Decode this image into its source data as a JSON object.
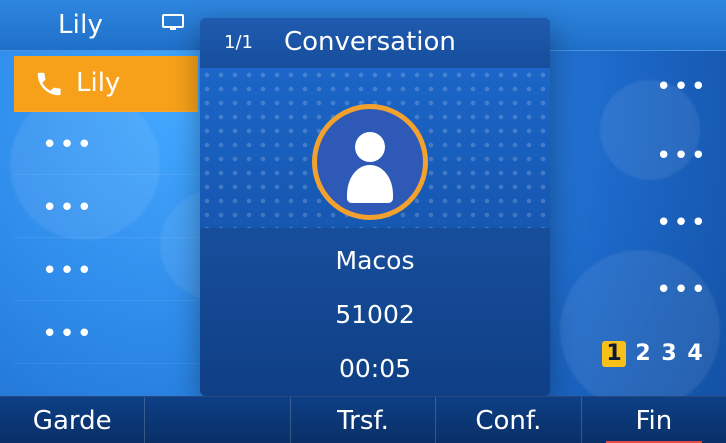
{
  "top": {
    "account_label": "Lily",
    "icon": "monitor-icon"
  },
  "lines": {
    "active": {
      "label": "Lily",
      "icon": "phone-icon",
      "bg_color": "#f7a11a"
    },
    "left_rows": [
      "•••",
      "•••",
      "•••",
      "•••"
    ],
    "right_rows": [
      "•••",
      "•••",
      "•••",
      "•••",
      "•••"
    ]
  },
  "call": {
    "count": "1/1",
    "title": "Conversation",
    "avatar_icon": "user-icon",
    "name": "Macos",
    "number": "51002",
    "duration": "00:05"
  },
  "pages": {
    "items": [
      "1",
      "2",
      "3",
      "4"
    ],
    "active_index": 0,
    "active_color": "#f7c11a"
  },
  "softkeys": [
    {
      "label": "Garde"
    },
    {
      "label": ""
    },
    {
      "label": "Trsf."
    },
    {
      "label": "Conf."
    },
    {
      "label": "Fin"
    }
  ],
  "colors": {
    "background": "#2b86e6",
    "card": "#0f3f85",
    "accent_orange": "#f2a12e",
    "end_accent": "#ff4a4a"
  }
}
